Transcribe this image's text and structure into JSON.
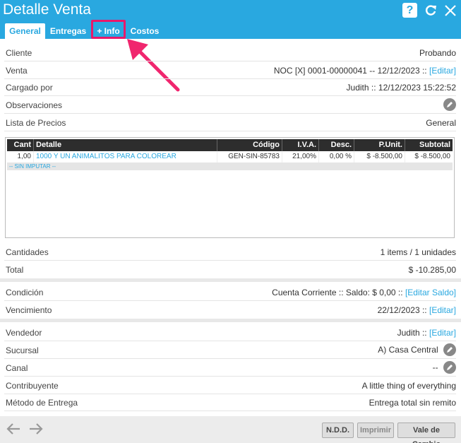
{
  "window": {
    "title": "Detalle Venta"
  },
  "tabs": [
    {
      "label": "General"
    },
    {
      "label": "Entregas"
    },
    {
      "label": "+ Info"
    },
    {
      "label": "Costos"
    }
  ],
  "info": {
    "cliente": {
      "label": "Cliente",
      "value": "Probando"
    },
    "venta": {
      "label": "Venta",
      "value": "NOC [X] 0001-00000041 -- 12/12/2023 ::",
      "action": "[Editar]"
    },
    "cargado": {
      "label": "Cargado por",
      "value": "Judith :: 12/12/2023 15:22:52"
    },
    "observaciones": {
      "label": "Observaciones"
    },
    "lista": {
      "label": "Lista de Precios",
      "value": "General"
    }
  },
  "grid": {
    "headers": [
      "Cant",
      "Detalle",
      "Código",
      "I.V.A.",
      "Desc.",
      "P.Unit.",
      "Subtotal"
    ],
    "rows": [
      {
        "cant": "1,00",
        "detalle": "1000 Y UN ANIMALITOS PARA COLOREAR",
        "codigo": "GEN-SIN-85783",
        "iva": "21,00%",
        "desc": "0,00 %",
        "punit": "$ -8.500,00",
        "subtotal": "$ -8.500,00"
      }
    ],
    "subrow": "-- SIN IMPUTAR --"
  },
  "totals": {
    "cantidades": {
      "label": "Cantidades",
      "value": "1 items / 1 unidades"
    },
    "total": {
      "label": "Total",
      "value": "$ -10.285,00"
    }
  },
  "pago": {
    "condicion": {
      "label": "Condición",
      "value": "Cuenta Corriente :: Saldo: $ 0,00 ::",
      "action": "[Editar Saldo]"
    },
    "vencimiento": {
      "label": "Vencimiento",
      "value": "22/12/2023 ::",
      "action": "[Editar]"
    }
  },
  "extra": {
    "vendedor": {
      "label": "Vendedor",
      "value": "Judith ::",
      "action": "[Editar]"
    },
    "sucursal": {
      "label": "Sucursal",
      "value": "A) Casa Central"
    },
    "canal": {
      "label": "Canal",
      "value": "--"
    },
    "contribuyente": {
      "label": "Contribuyente",
      "value": "A little thing of everything"
    },
    "metodo": {
      "label": "Método de Entrega",
      "value": "Entrega total sin remito"
    }
  },
  "footer": {
    "ndd": "N.D.D.",
    "imprimir": "Imprimir",
    "vale": "Vale de Cambio"
  },
  "colors": {
    "accent": "#29a8e0",
    "highlight": "#e8196b",
    "header_dark": "#2d2d2d"
  }
}
